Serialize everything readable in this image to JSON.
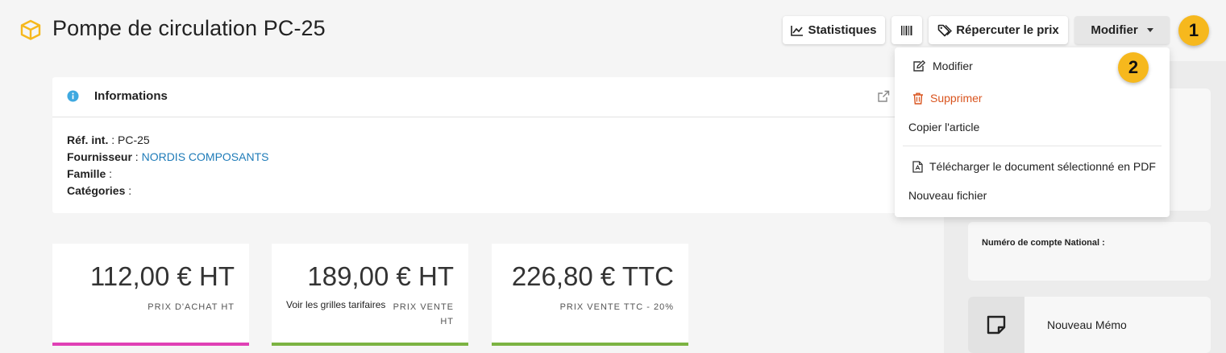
{
  "header": {
    "title": "Pompe de circulation PC-25",
    "buttons": {
      "stats": "Statistiques",
      "price": "Répercuter le prix",
      "modify": "Modifier"
    },
    "badges": {
      "one": "1",
      "two": "2"
    }
  },
  "dropdown": {
    "items": [
      {
        "label": "Modifier",
        "icon": "edit-icon"
      },
      {
        "label": "Supprimer",
        "icon": "trash-icon",
        "color": "#d9541e"
      },
      {
        "label": "Copier l'article"
      },
      {
        "label": "Télécharger le document sélectionné en PDF",
        "icon": "pdf-file-icon"
      },
      {
        "label": "Nouveau fichier"
      }
    ]
  },
  "info": {
    "title": "Informations",
    "fields": {
      "ref_label": "Réf. int.",
      "ref_value": "PC-25",
      "supplier_label": "Fournisseur",
      "supplier_value": "NORDIS COMPOSANTS",
      "family_label": "Famille",
      "family_value": "",
      "categories_label": "Catégories",
      "categories_value": ""
    }
  },
  "prices": [
    {
      "value": "112,00 € HT",
      "label": "PRIX D'ACHAT HT",
      "color": "#e040b5"
    },
    {
      "value": "189,00 € HT",
      "label": "PRIX VENTE HT",
      "link": "Voir les grilles tarifaires",
      "color": "#7cb342"
    },
    {
      "value": "226,80 € TTC",
      "label": "PRIX VENTE TTC - 20%",
      "color": "#7cb342"
    }
  ],
  "sidebar": {
    "account_label": "Numéro de compte National :",
    "memo_label": "Nouveau Mémo"
  },
  "colors": {
    "accent": "#f6b81d",
    "link": "#1e7bb8",
    "danger": "#d9541e"
  }
}
